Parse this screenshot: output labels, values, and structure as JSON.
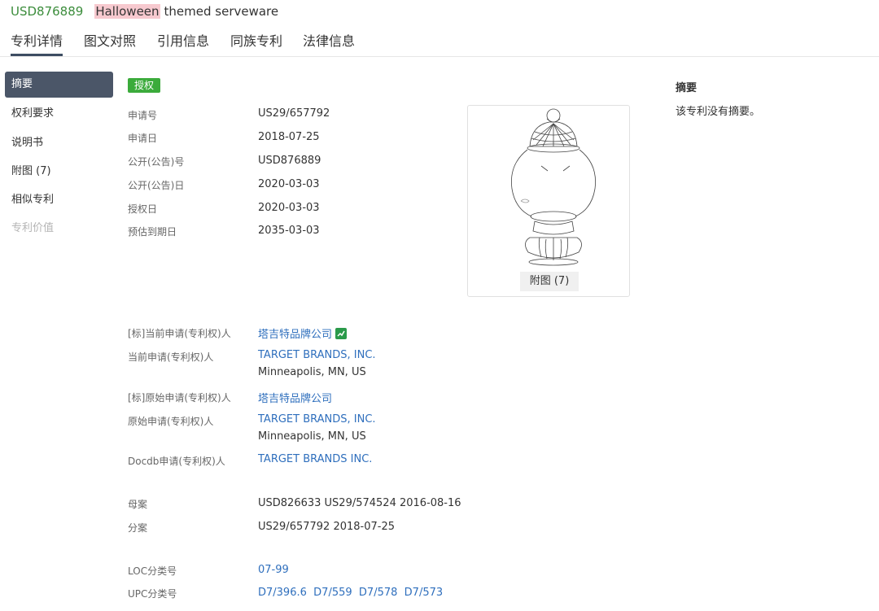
{
  "header": {
    "pub_no": "USD876889",
    "title_highlight": "Halloween",
    "title_rest": "themed serveware"
  },
  "tabs": [
    "专利详情",
    "图文对照",
    "引用信息",
    "同族专利",
    "法律信息"
  ],
  "sidebar": {
    "items": [
      {
        "label": "摘要",
        "state": "active"
      },
      {
        "label": "权利要求",
        "state": "normal"
      },
      {
        "label": "说明书",
        "state": "normal"
      },
      {
        "label": "附图 (7)",
        "state": "normal"
      },
      {
        "label": "相似专利",
        "state": "normal"
      },
      {
        "label": "专利价值",
        "state": "disabled"
      }
    ]
  },
  "status_badge": "授权",
  "basic_info": [
    {
      "label": "申请号",
      "value": "US29/657792"
    },
    {
      "label": "申请日",
      "value": "2018-07-25"
    },
    {
      "label": "公开(公告)号",
      "value": "USD876889"
    },
    {
      "label": "公开(公告)日",
      "value": "2020-03-03"
    },
    {
      "label": "授权日",
      "value": "2020-03-03"
    },
    {
      "label": "预估到期日",
      "value": "2035-03-03"
    }
  ],
  "figure": {
    "label": "附图 (7)"
  },
  "applicants": {
    "std_current_label": "[标]当前申请(专利权)人",
    "std_current_value": "塔吉特品牌公司",
    "current_label": "当前申请(专利权)人",
    "current_name": "TARGET BRANDS, INC.",
    "current_location": "Minneapolis, MN, US",
    "std_original_label": "[标]原始申请(专利权)人",
    "std_original_value": "塔吉特品牌公司",
    "original_label": "原始申请(专利权)人",
    "original_name": "TARGET BRANDS, INC.",
    "original_location": "Minneapolis, MN, US",
    "docdb_label": "Docdb申请(专利权)人",
    "docdb_value": "TARGET BRANDS INC."
  },
  "family": {
    "parent_label": "母案",
    "parent_value": "USD826633 US29/574524 2016-08-16",
    "child_label": "分案",
    "child_value": "US29/657792 2018-07-25"
  },
  "classification": {
    "loc_label": "LOC分类号",
    "loc_value": "07-99",
    "upc_label": "UPC分类号",
    "upc_values": [
      "D7/396.6",
      "D7/559",
      "D7/578",
      "D7/573"
    ]
  },
  "abstract": {
    "title": "摘要",
    "text": "该专利没有摘要。"
  },
  "colors": {
    "pub_no": "#3c8d3c",
    "highlight": "#f7c9cf",
    "sidebar_active": "#4b5668",
    "badge": "#3bab3b",
    "link": "#2f6fbd"
  }
}
